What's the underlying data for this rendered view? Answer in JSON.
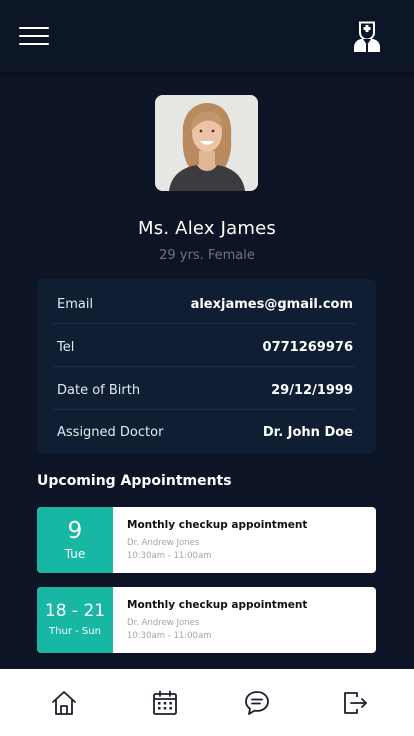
{
  "header": {
    "menu_icon": "hamburger-menu-icon",
    "doctor_icon": "doctor-icon"
  },
  "profile": {
    "name": "Ms. Alex James",
    "subtitle": "29 yrs. Female"
  },
  "info": [
    {
      "label": "Email",
      "value": "alexjames@gmail.com"
    },
    {
      "label": "Tel",
      "value": "0771269976"
    },
    {
      "label": "Date of Birth",
      "value": "29/12/1999"
    },
    {
      "label": "Assigned Doctor",
      "value": "Dr. John Doe"
    }
  ],
  "appointments_title": "Upcoming Appointments",
  "appointments": [
    {
      "date": "9",
      "day": "Tue",
      "title": "Monthly checkup appointment",
      "doctor": "Dr. Andrew Jones",
      "time": "10:30am - 11:00am"
    },
    {
      "date": "18 - 21",
      "day": "Thur - Sun",
      "title": "Monthly checkup appointment",
      "doctor": "Dr. Andrew Jones",
      "time": "10:30am - 11:00am"
    }
  ],
  "nav": [
    "home-icon",
    "calendar-icon",
    "chat-icon",
    "logout-icon"
  ],
  "colors": {
    "background": "#0c1426",
    "card": "#0f1e33",
    "accent": "#17b7a3",
    "muted_text": "#6c7383"
  }
}
